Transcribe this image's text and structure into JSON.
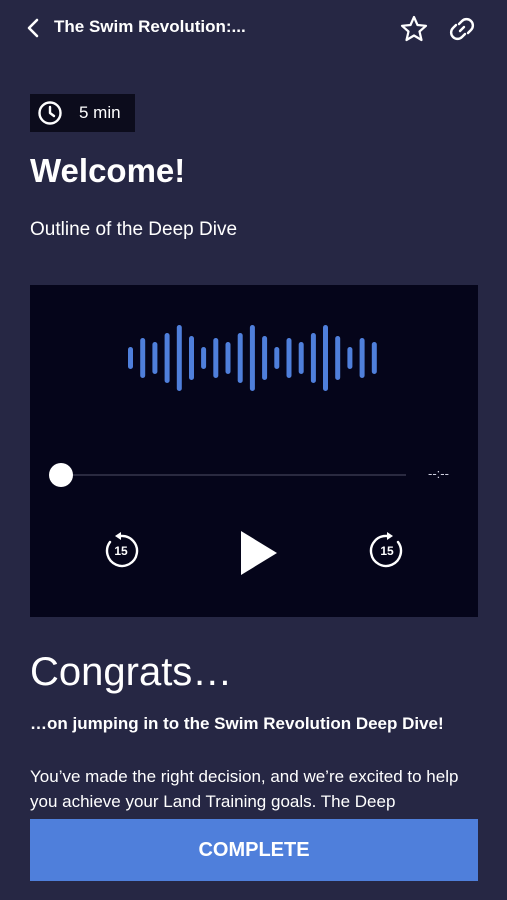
{
  "header": {
    "title": "The Swim Revolution:...",
    "back_icon": "chevron-left-icon",
    "favorite_icon": "star-icon",
    "share_icon": "link-icon"
  },
  "lesson": {
    "duration": "5 min",
    "duration_icon": "clock-icon",
    "title": "Welcome!",
    "subtitle": "Outline of the Deep Dive"
  },
  "player": {
    "time_remaining": "--:--",
    "rewind_seconds": "15",
    "forward_seconds": "15",
    "progress": 0,
    "wave_color": "#4f7fdb"
  },
  "content": {
    "heading": "Congrats…",
    "lead": "…on jumping in to the Swim Revolution Deep Dive!",
    "body": "You’ve made the right decision, and we’re excited to help you achieve your Land Training goals. The Deep"
  },
  "footer": {
    "complete_label": "COMPLETE"
  },
  "colors": {
    "background": "#262744",
    "player_background": "#05051a",
    "accent": "#4f7fdb"
  }
}
